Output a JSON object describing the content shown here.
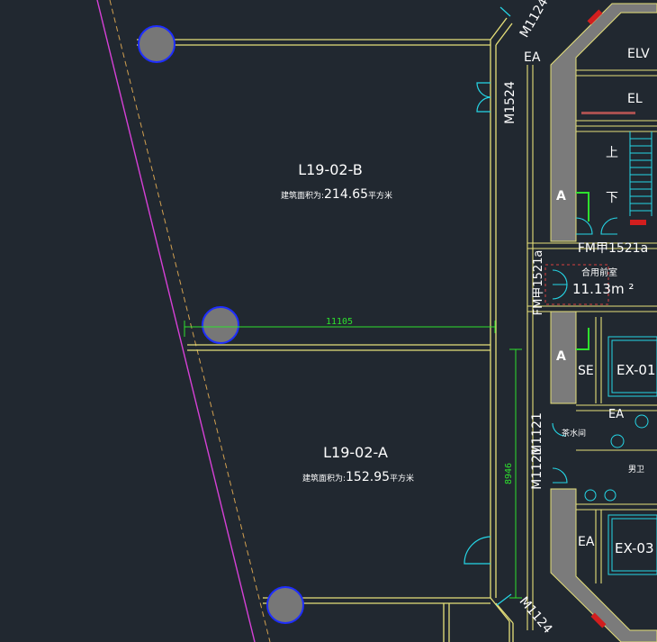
{
  "colors": {
    "background": "#212830",
    "wall": "#e6e07a",
    "core_fill": "#7b7b7b",
    "dimension": "#2ee02e",
    "door": "#25d6e6",
    "column": "#777777",
    "column_stroke": "#1e2eff",
    "boundary": "#d640d6",
    "dashed": "#d2a050",
    "red_fixture": "#d21e1e",
    "text": "#ffffff"
  },
  "rooms": [
    {
      "id": "L19-02-B",
      "area_label": "建筑面积为:",
      "area_value": "214.65",
      "area_unit": "平方米"
    },
    {
      "id": "L19-02-A",
      "area_label": "建筑面积为:",
      "area_value": "152.95",
      "area_unit": "平方米"
    }
  ],
  "dimensions": {
    "horizontal": "11105",
    "vertical": "8946"
  },
  "doors": {
    "m1524": "M1524",
    "m1124_top": "M1124",
    "m1124_bottom": "M1124",
    "fm1521a_right": "FM甲1521a",
    "fm1521a_left": "FM甲1521a",
    "m1121a": "M1121",
    "m1121b": "M1121"
  },
  "core_labels": {
    "ea_top": "EA",
    "elv": "ELV",
    "el": "EL",
    "stair_up": "上",
    "stair_down": "下",
    "axis_a1": "A",
    "axis_a2": "A",
    "refuge_room": "合用前室",
    "refuge_area": "11.13m ²",
    "se": "SE",
    "ex01": "EX-01",
    "ea_mid": "EA",
    "janitor": "茶水间",
    "ea_low": "EA",
    "ex03": "EX-03",
    "toilet_label": "男卫"
  }
}
